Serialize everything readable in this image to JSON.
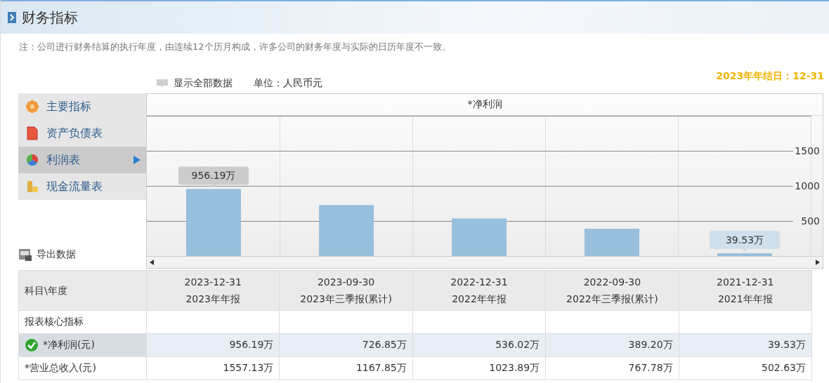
{
  "header": {
    "title": "财务指标"
  },
  "note": "注：公司进行财务结算的执行年度，由连续12个历月构成，许多公司的财务年度与实际的日历年度不一致。",
  "toolbar": {
    "show_all": "显示全部数据",
    "unit": "单位：人民币元",
    "year_end": "2023年年结日：12-31"
  },
  "sidebar": {
    "items": [
      {
        "label": "主要指标",
        "selected": false
      },
      {
        "label": "资产负债表",
        "selected": false
      },
      {
        "label": "利润表",
        "selected": true
      },
      {
        "label": "现金流量表",
        "selected": false
      }
    ],
    "export": "导出数据"
  },
  "chart": {
    "chart_data": {
      "type": "bar",
      "title": "*净利润",
      "values": [
        956.19,
        726.85,
        536.02,
        389.2,
        39.53
      ],
      "ylim": [
        0,
        2000
      ],
      "yticks": [
        500,
        1000,
        1500
      ],
      "grid": true,
      "value_labels": [
        "956.19万",
        null,
        null,
        null,
        "39.53万"
      ]
    }
  },
  "table": {
    "corner": "科目\\年度",
    "columns": [
      {
        "date": "2023-12-31",
        "report": "2023年年报"
      },
      {
        "date": "2023-09-30",
        "report": "2023年三季报(累计)"
      },
      {
        "date": "2022-12-31",
        "report": "2022年年报"
      },
      {
        "date": "2022-09-30",
        "report": "2022年三季报(累计)"
      },
      {
        "date": "2021-12-31",
        "report": "2021年年报"
      }
    ],
    "rows": [
      {
        "kind": "section",
        "label": "报表核心指标",
        "selected": false
      },
      {
        "kind": "item",
        "label": "*净利润(元)",
        "selected": true,
        "cells": [
          "956.19万",
          "726.85万",
          "536.02万",
          "389.20万",
          "39.53万"
        ]
      },
      {
        "kind": "item",
        "label": "*营业总收入(元)",
        "selected": false,
        "cells": [
          "1557.13万",
          "1167.85万",
          "1023.89万",
          "767.78万",
          "502.63万"
        ]
      }
    ]
  }
}
